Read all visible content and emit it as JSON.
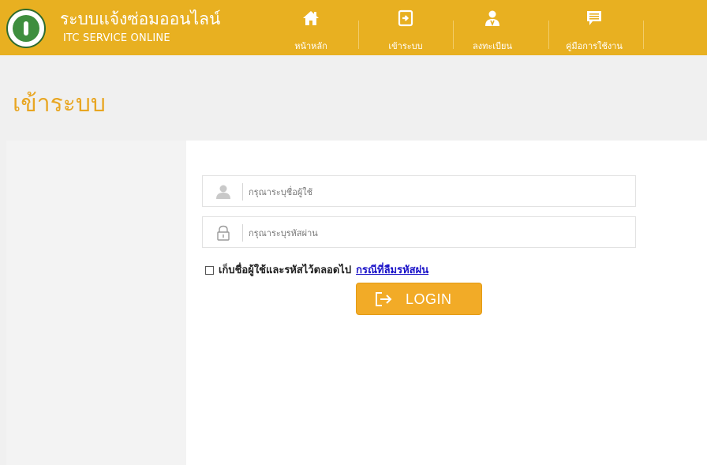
{
  "header": {
    "brand_th": "ระบบแจ้งซ่อมออนไลน์",
    "brand_en": "ITC SERVICE ONLINE",
    "nav": [
      {
        "label": "หน้าหลัก",
        "icon": "home-icon"
      },
      {
        "label": "เข้าระบบ",
        "icon": "sign-in-icon"
      },
      {
        "label": "ลงทะเบียน",
        "icon": "user-register-icon"
      },
      {
        "label": "คู่มือการใช้งาน",
        "icon": "manual-chat-icon"
      }
    ]
  },
  "page": {
    "title": "เข้าระบบ"
  },
  "login": {
    "username_placeholder": "กรุณาระบุชื่อผู้ใช้",
    "username_value": "",
    "password_placeholder": "กรุณาระบุรหัสผ่าน",
    "password_value": "",
    "remember_label": "เก็บชื่อผู้ใช้และรหัสไว้ตลอดไป",
    "forgot_link": "กรณีที่ลืมรหัสผ่น",
    "login_button": "LOGIN"
  },
  "colors": {
    "header_bg": "#e8b021",
    "accent": "#f2ab27",
    "title": "#e8a622",
    "link": "#1a12c8"
  }
}
